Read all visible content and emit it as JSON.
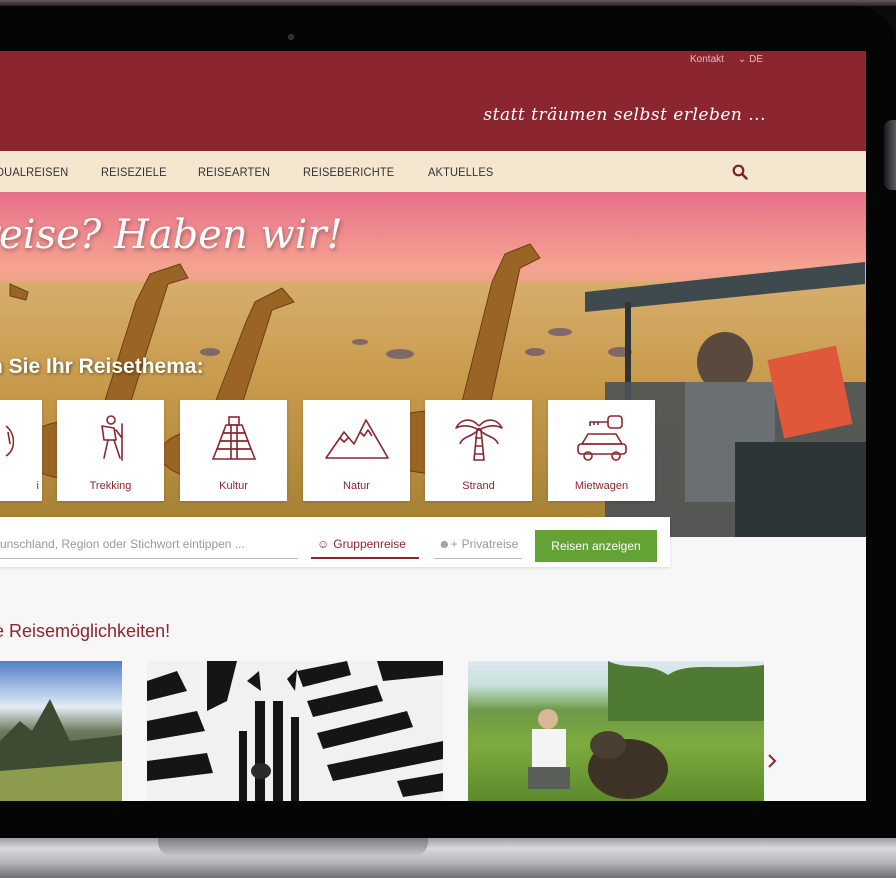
{
  "utility_nav": {
    "contact": "Kontakt",
    "language": "DE",
    "language_chevron": "chevron-down-icon"
  },
  "header": {
    "slogan": "statt träumen selbst erleben ..."
  },
  "main_nav": {
    "items": [
      "DUALREISEN",
      "REISEZIELE",
      "REISEARTEN",
      "REISEBERICHTE",
      "AKTUELLES"
    ],
    "search_icon": "search-icon"
  },
  "hero": {
    "headline": "reise? Haben wir!",
    "subhead": "n Sie Ihr Reisethema:"
  },
  "themes": [
    {
      "label": "i",
      "icon": "rider-icon"
    },
    {
      "label": "Trekking",
      "icon": "hiker-icon"
    },
    {
      "label": "Kultur",
      "icon": "pyramid-icon"
    },
    {
      "label": "Natur",
      "icon": "mountains-icon"
    },
    {
      "label": "Strand",
      "icon": "palm-icon"
    },
    {
      "label": "Mietwagen",
      "icon": "car-key-icon"
    }
  ],
  "search": {
    "placeholder": "unschland, Region oder Stichwort eintippen ...",
    "group_label": "Gruppenreise",
    "private_label": "Privatreise",
    "submit_label": "Reisen anzeigen"
  },
  "teaser": {
    "title": "e Reisemöglichkeiten!",
    "next_icon": "chevron-right-icon"
  },
  "colors": {
    "brand": "#8b2530",
    "nav_bg": "#f4e6cf",
    "accent_green": "#63a234"
  }
}
